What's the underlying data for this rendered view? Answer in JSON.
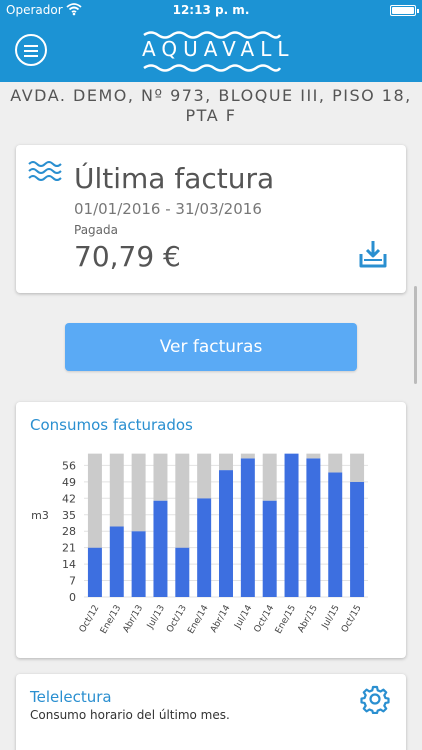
{
  "status_bar": {
    "carrier": "Operador",
    "time": "12:13 p. m."
  },
  "header": {
    "brand": "AQUAVALL",
    "brand_color": "#1c93d4"
  },
  "address": {
    "line1": "AVDA. DEMO, Nº 973, BLOQUE III, PISO 18,",
    "line2": "PTA F"
  },
  "last_invoice": {
    "title": "Última factura",
    "period": "01/01/2016 - 31/03/2016",
    "status": "Pagada",
    "amount": "70,79 €",
    "icon": "waves-icon",
    "download_icon": "download-icon"
  },
  "buttons": {
    "ver_facturas": "Ver facturas",
    "button_color": "#5aaaf5"
  },
  "chart_section": {
    "title": "Consumos facturados"
  },
  "chart_data": {
    "type": "bar",
    "stacked": true,
    "title": "Consumos facturados",
    "ylabel": "m3",
    "xlabel": "",
    "ylim": [
      0,
      60
    ],
    "yticks": [
      0,
      7,
      14,
      21,
      28,
      35,
      42,
      49,
      56
    ],
    "grid": true,
    "categories": [
      "Oct/12",
      "Ene/13",
      "Abr/13",
      "Jul/13",
      "Oct/13",
      "Ene/14",
      "Abr/14",
      "Jul/14",
      "Oct/14",
      "Ene/15",
      "Abr/15",
      "Jul/15",
      "Oct/15"
    ],
    "category_labels_shown": [
      "Oct/12",
      "Ene/13",
      "Abr/13",
      "Jul/13",
      "Oct/13",
      "Ene/14",
      "Abr/14",
      "Jul/14",
      "Oct/14",
      "Ene/15",
      "Abr/15",
      "Jul/15",
      "Oct/15"
    ],
    "series": [
      {
        "color": "#3d6fe0",
        "values": [
          21,
          30,
          28,
          41,
          21,
          42,
          54,
          59,
          41,
          61,
          59,
          53,
          49
        ]
      },
      {
        "color": "#cbcbcb",
        "values": [
          40,
          31,
          33,
          20,
          40,
          19,
          7,
          2,
          20,
          0,
          2,
          8,
          12
        ]
      }
    ]
  },
  "telelectura": {
    "title": "Telelectura",
    "subtitle": "Consumo horario del último mes.",
    "icon": "gear-icon"
  }
}
